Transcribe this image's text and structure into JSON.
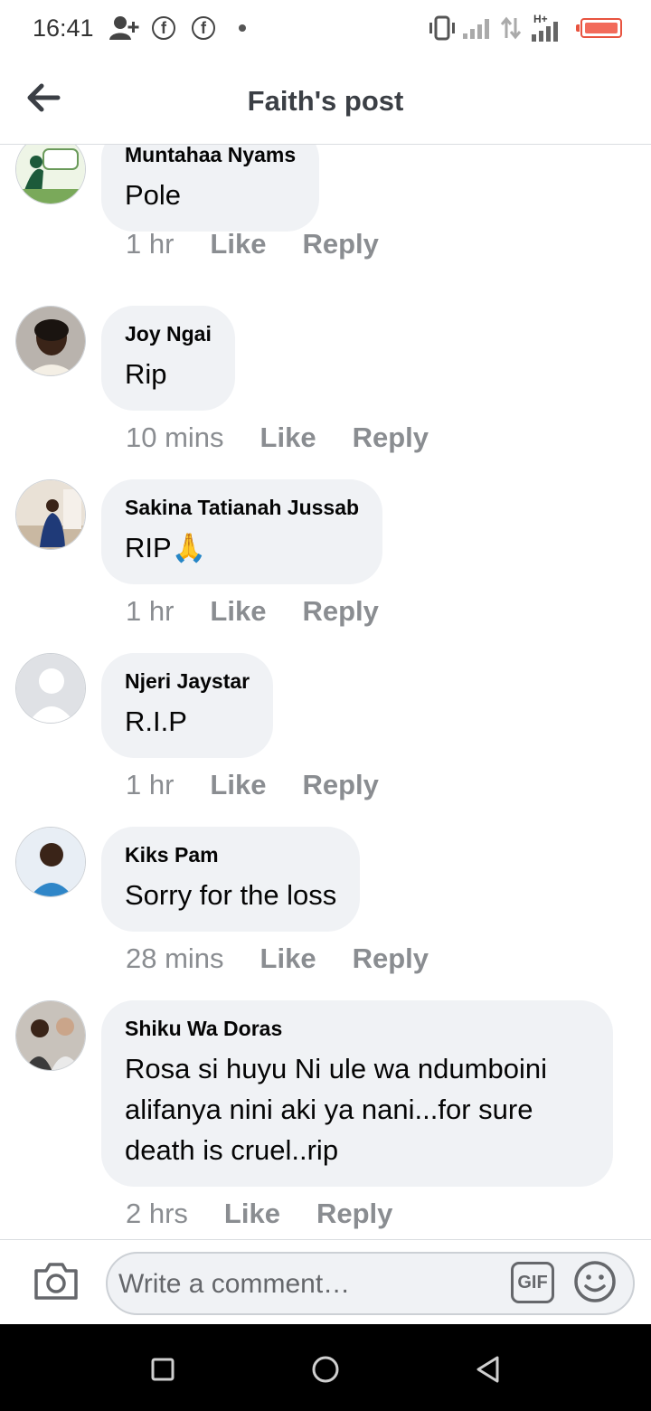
{
  "status_bar": {
    "time": "16:41",
    "icons": [
      "add-person-icon",
      "facebook-icon",
      "facebook-icon",
      "dot-icon",
      "vibrate-icon",
      "signal-icon",
      "data-arrows-icon",
      "hplus-signal-icon",
      "battery-icon"
    ],
    "hplus_label": "H+",
    "battery_color": "#e8533f"
  },
  "header": {
    "title": "Faith's post",
    "back_icon": "arrow-left-icon"
  },
  "comments": [
    {
      "name": "Muntahaa Nyams",
      "text": "Pole",
      "time": "1 hr",
      "like": "Like",
      "reply": "Reply"
    },
    {
      "name": "Joy Ngai",
      "text": "Rip",
      "time": "10 mins",
      "like": "Like",
      "reply": "Reply"
    },
    {
      "name": "Sakina Tatianah Jussab",
      "text": "RIP🙏",
      "time": "1 hr",
      "like": "Like",
      "reply": "Reply"
    },
    {
      "name": "Njeri Jaystar",
      "text": "R.I.P",
      "time": "1 hr",
      "like": "Like",
      "reply": "Reply"
    },
    {
      "name": "Kiks Pam",
      "text": "Sorry for the loss",
      "time": "28 mins",
      "like": "Like",
      "reply": "Reply"
    },
    {
      "name": "Shiku Wa Doras",
      "text": "Rosa si huyu Ni  ule wa ndumboini alifanya nini aki ya nani...for sure death is cruel..rip",
      "time": "2 hrs",
      "like": "Like",
      "reply": "Reply"
    }
  ],
  "composer": {
    "placeholder": "Write a comment…",
    "gif_label": "GIF",
    "camera_icon": "camera-icon",
    "emoji_icon": "emoji-icon"
  },
  "colors": {
    "bubble": "#f0f2f5",
    "meta_text": "#8a8d91",
    "title_text": "#3b3f45"
  }
}
